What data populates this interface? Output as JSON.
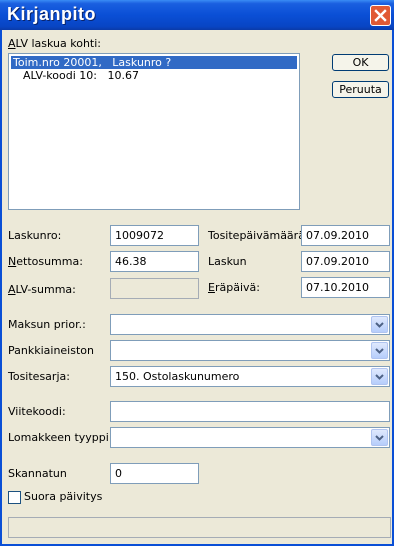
{
  "window": {
    "title": "Kirjanpito",
    "close_icon": "close-icon"
  },
  "alv_section": {
    "label": "ALV laskua kohti:",
    "items": [
      {
        "text": "Toim.nro 20001,   Laskunro ?",
        "selected": true
      },
      {
        "text": "ALV-koodi 10:   10.67",
        "selected": false
      }
    ]
  },
  "buttons": {
    "ok": "OK",
    "cancel": "Peruuta"
  },
  "invoice": {
    "laskunro_label": "Laskunro:",
    "laskunro_value": "1009072",
    "netto_label": "Nettosumma:",
    "netto_value": "46.38",
    "alv_summa_label": "ALV-summa:",
    "alv_summa_value": "",
    "tositepvm_label": "Tositepäivämäärä:",
    "tositepvm_value": "07.09.2010",
    "laskun_label": "Laskun",
    "laskun_value": "07.09.2010",
    "erapaiva_label": "Eräpäivä:",
    "erapaiva_value": "07.10.2010"
  },
  "payment": {
    "maksun_prior_label": "Maksun prior.:",
    "maksun_prior_value": "",
    "pankki_label": "Pankkiaineiston",
    "pankki_value": "",
    "tositesarja_label": "Tositesarja:",
    "tositesarja_value": "150. Ostolaskunumero"
  },
  "reference": {
    "viitekoodi_label": "Viitekoodi:",
    "viitekoodi_value": "",
    "lomake_label": "Lomakkeen tyyppi:",
    "lomake_value": ""
  },
  "scan": {
    "skannatun_label": "Skannatun",
    "skannatun_value": "0",
    "suora_label": "Suora päivitys",
    "suora_checked": false
  },
  "status": {
    "text": ""
  },
  "colors": {
    "titlebar": "#0a4fd6",
    "selection": "#316ac5",
    "close": "#e15a35"
  }
}
